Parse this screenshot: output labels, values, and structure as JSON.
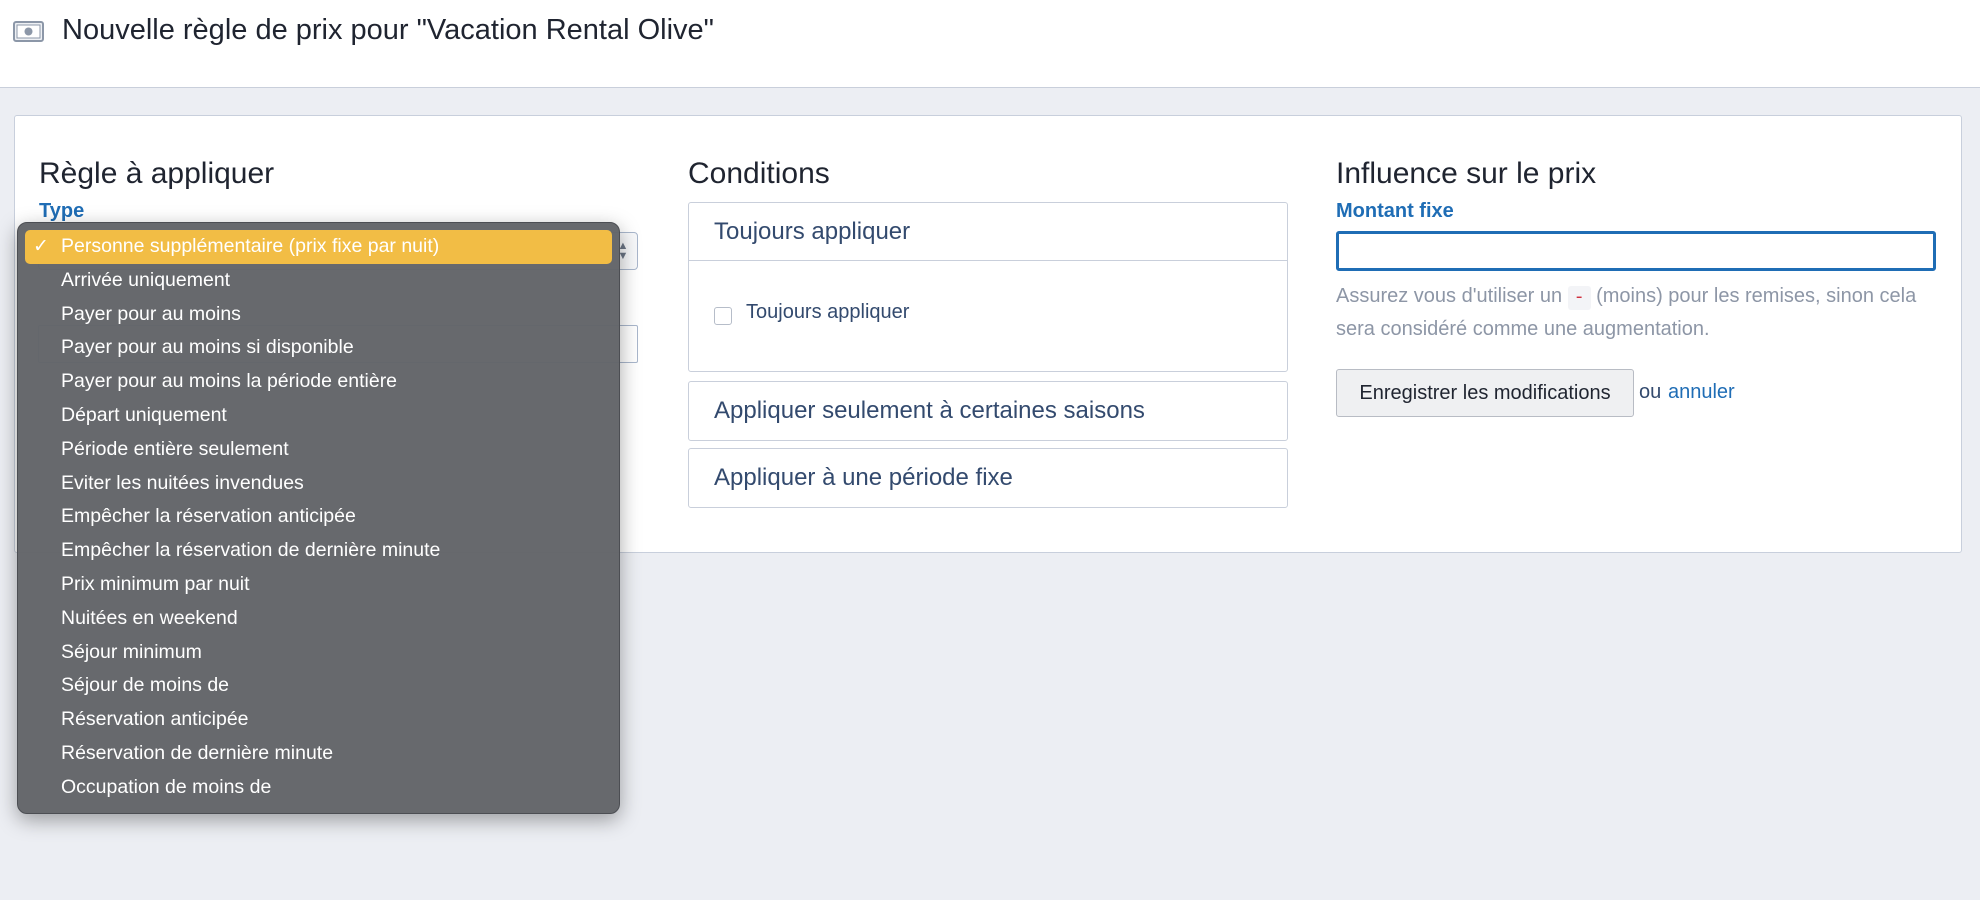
{
  "header": {
    "icon": "money-bill-icon",
    "title": "Nouvelle règle de prix pour \"Vacation Rental Olive\""
  },
  "rule_section": {
    "heading": "Règle à appliquer",
    "type_label": "Type"
  },
  "type_dropdown": {
    "selected": "Personne supplémentaire (prix fixe par nuit)",
    "options": [
      "Personne supplémentaire (prix fixe par nuit)",
      "Arrivée uniquement",
      "Payer pour au moins",
      "Payer pour au moins si disponible",
      "Payer pour au moins la période entière",
      "Départ uniquement",
      "Période entière seulement",
      "Eviter les nuitées invendues",
      "Empêcher la réservation anticipée",
      "Empêcher la réservation de dernière minute",
      "Prix minimum par nuit",
      "Nuitées en weekend",
      "Séjour minimum",
      "Séjour de moins de",
      "Réservation anticipée",
      "Réservation de dernière minute",
      "Occupation de moins de"
    ],
    "colors": {
      "selected_bg": "#f2bd45",
      "menu_bg": "#626468"
    }
  },
  "conditions": {
    "heading": "Conditions",
    "panels": [
      {
        "title": "Toujours appliquer",
        "open": true,
        "checkbox_label": "Toujours appliquer",
        "checked": false
      },
      {
        "title": "Appliquer seulement à certaines saisons",
        "open": false
      },
      {
        "title": "Appliquer à une période fixe",
        "open": false
      }
    ]
  },
  "price_influence": {
    "heading": "Influence sur le prix",
    "amount_label": "Montant fixe",
    "amount_value": "",
    "help_before": "Assurez vous d'utiliser un ",
    "help_code": "-",
    "help_after": " (moins) pour les remises, sinon cela sera considéré comme une augmentation.",
    "save_label": "Enregistrer les modifications",
    "or_text": "ou",
    "cancel_label": "annuler"
  },
  "colors": {
    "accent": "#1f6db5",
    "page_bg": "#eceef3"
  }
}
